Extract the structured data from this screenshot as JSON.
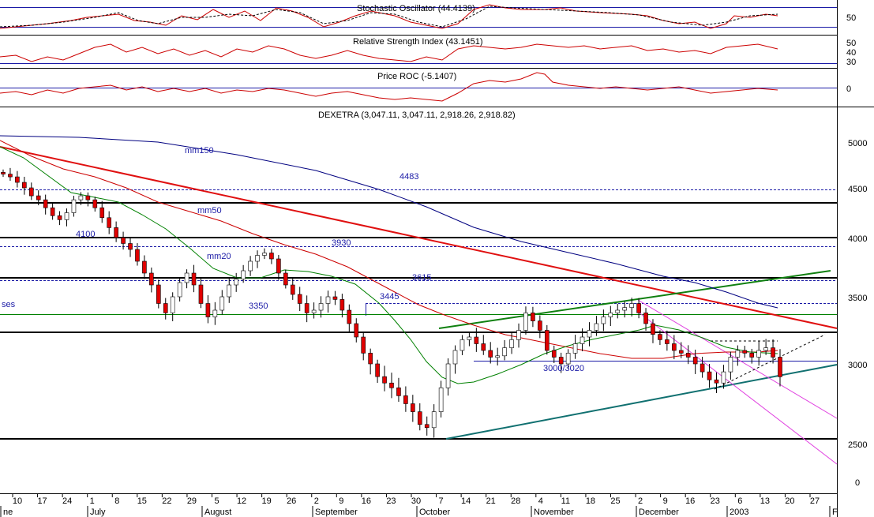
{
  "panels": {
    "stochastic": {
      "title": "Stochastic Oscillator (44.4139)",
      "ticks": [
        "50"
      ]
    },
    "rsi": {
      "title": "Relative Strength Index (43.1451)",
      "ticks": [
        "50",
        "40",
        "30"
      ]
    },
    "roc": {
      "title": "Price ROC (-5.1407)",
      "ticks": [
        "0"
      ]
    },
    "price": {
      "title": "DEXETRA (3,047.11, 3,047.11, 2,918.26, 2,918.82)"
    }
  },
  "annotations": {
    "mm150": "mm150",
    "mm50": "mm50",
    "mm20": "mm20",
    "l4483": "4483",
    "l4100": "4100",
    "l3930": "3930",
    "l3615": "3615",
    "l3445": "3445",
    "l3350": "3350",
    "l3000": "3000/3020",
    "ses": "ses"
  },
  "colors": {
    "candle_down": "#e00000",
    "candle_up": "#ffffff",
    "mm20": "#008000",
    "mm50": "#cc0000",
    "mm150": "#000080",
    "resistance_red": "#e01010",
    "channel_green": "#108010",
    "support_teal": "#107070",
    "channel_magenta": "#e040e0",
    "level_blue": "#1a1aa6"
  },
  "chart_data": {
    "type": "candlestick",
    "title": "DEXETRA (3,047.11, 3,047.11, 2,918.26, 2,918.82)",
    "ylim": [
      2300,
      5400
    ],
    "yticks": [
      "5000",
      "4500",
      "4000",
      "3500",
      "3000",
      "2500",
      "0"
    ],
    "x_day_ticks": [
      "10",
      "17",
      "24",
      "1",
      "8",
      "15",
      "22",
      "29",
      "5",
      "12",
      "19",
      "26",
      "2",
      "9",
      "16",
      "23",
      "30",
      "7",
      "14",
      "21",
      "28",
      "4",
      "11",
      "18",
      "25",
      "2",
      "9",
      "16",
      "23",
      "6",
      "13",
      "20",
      "27"
    ],
    "month_labels": [
      "ne",
      "July",
      "August",
      "September",
      "October",
      "November",
      "December",
      "2003",
      "F"
    ],
    "horizontal_levels": [
      4483,
      4350,
      4010,
      3930,
      3660,
      3640,
      3445,
      3350,
      3230,
      3020,
      2530
    ],
    "last": {
      "open": 3047.11,
      "high": 3047.11,
      "low": 2918.26,
      "close": 2918.82
    },
    "approx_closes": [
      4650,
      4620,
      4560,
      4500,
      4420,
      4380,
      4300,
      4220,
      4180,
      4250,
      4380,
      4420,
      4380,
      4300,
      4200,
      4100,
      4000,
      3950,
      3900,
      3800,
      3700,
      3600,
      3450,
      3380,
      3500,
      3620,
      3700,
      3600,
      3450,
      3350,
      3400,
      3500,
      3600,
      3650,
      3720,
      3800,
      3850,
      3870,
      3820,
      3700,
      3600,
      3520,
      3450,
      3380,
      3400,
      3450,
      3500,
      3480,
      3400,
      3300,
      3200,
      3080,
      3000,
      2920,
      2880,
      2850,
      2800,
      2750,
      2700,
      2620,
      2600,
      2700,
      2850,
      3000,
      3100,
      3180,
      3200,
      3150,
      3100,
      3050,
      3060,
      3120,
      3180,
      3250,
      3380,
      3320,
      3250,
      3100,
      3050,
      3000,
      3080,
      3150,
      3200,
      3250,
      3300,
      3350,
      3380,
      3400,
      3420,
      3450,
      3380,
      3300,
      3220,
      3180,
      3150,
      3100,
      3080,
      3050,
      3000,
      2950,
      2900,
      2880,
      2950,
      3050,
      3100,
      3080,
      3050,
      3100,
      3120,
      3050,
      2919
    ],
    "oscillators": {
      "stochastic": 44.4139,
      "rsi": 43.1451,
      "price_roc": -5.1407
    }
  }
}
